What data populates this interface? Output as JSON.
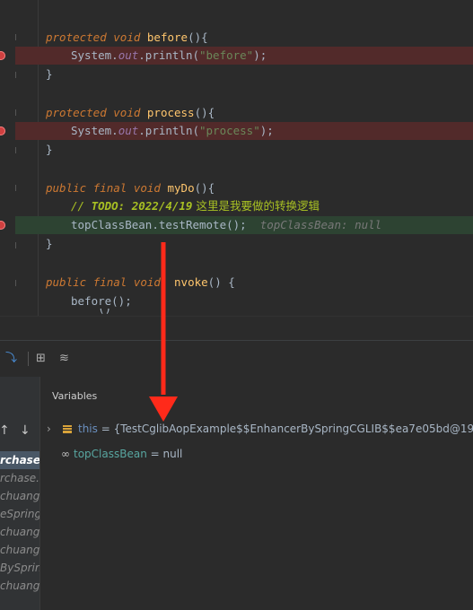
{
  "code": {
    "lines": {
      "before_sig": {
        "mod1": "protected",
        "mod2": "void",
        "name": "before",
        "rest": "(){"
      },
      "before_body": {
        "cls": "System.",
        "field": "out",
        "call": ".println(",
        "str": "\"before\"",
        "end": ");"
      },
      "before_close": "}",
      "process_sig": {
        "mod1": "protected",
        "mod2": "void",
        "name": "process",
        "rest": "(){"
      },
      "process_body": {
        "cls": "System.",
        "field": "out",
        "call": ".println(",
        "str": "\"process\"",
        "end": ");"
      },
      "process_close": "}",
      "mydo_sig": {
        "mod1": "public",
        "mod2": "final",
        "mod3": "void",
        "name": "myDo",
        "rest": "(){"
      },
      "mydo_todo": {
        "prefix": "// ",
        "todo": "TODO: 2022/4/19",
        "comment": " 这里是我要做的转换逻辑"
      },
      "mydo_call": {
        "obj": "topClassBean",
        "call": ".testRemote();",
        "inlay": "topClassBean: null"
      },
      "mydo_close": "}",
      "invoke_sig": {
        "mod1": "public",
        "mod2": "final",
        "mod3": "void",
        "name_partial": "nvoke",
        "rest": "() {"
      },
      "invoke_before": "before();",
      "invoke_partial": "    ()"
    }
  },
  "debugger": {
    "variables_title": "Variables",
    "frames": [
      "rchase.c",
      "rchase.c",
      "chuang.p",
      "eSpring",
      "chuang.",
      "chuang.",
      "BySpring",
      "chuang."
    ],
    "variables": [
      {
        "name": "this",
        "value": "= {TestCglibAopExample$$EnhancerBySpringCGLIB$$ea7e05bd@19"
      },
      {
        "name": "topClassBean",
        "value": "= null"
      }
    ]
  },
  "colors": {
    "breakpoint_line": "#522a2a",
    "current_line": "#2d4332",
    "annotation_arrow": "#ff2a1a"
  },
  "icons": [
    "breakpoint-icon",
    "step-into-icon",
    "evaluate-icon",
    "threads-icon",
    "frame-up-icon",
    "frame-down-icon",
    "expand-icon",
    "object-icon",
    "watch-icon"
  ]
}
